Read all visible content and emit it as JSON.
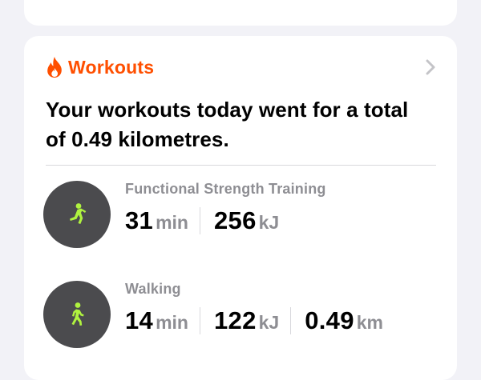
{
  "workouts_card": {
    "title": "Workouts",
    "summary": "Your workouts today went for a total of 0.49 kilometres.",
    "accent_color": "#ff4f00",
    "activity_icon_color": "#b0f33f",
    "items": [
      {
        "name": "Functional Strength Training",
        "icon": "functional-strength-icon",
        "duration_value": "31",
        "duration_unit": "min",
        "energy_value": "256",
        "energy_unit": "kJ"
      },
      {
        "name": "Walking",
        "icon": "walking-icon",
        "duration_value": "14",
        "duration_unit": "min",
        "energy_value": "122",
        "energy_unit": "kJ",
        "distance_value": "0.49",
        "distance_unit": "km"
      }
    ]
  }
}
